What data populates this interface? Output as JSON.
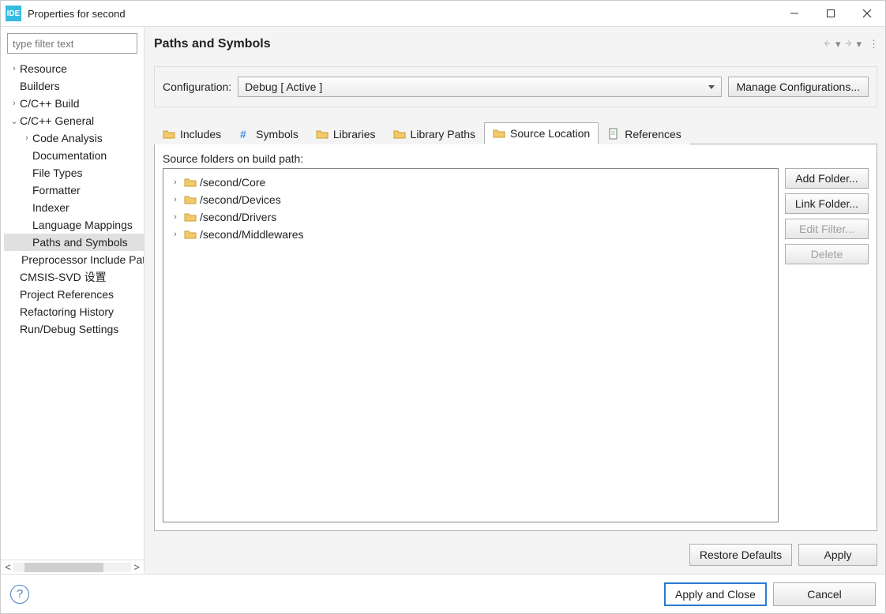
{
  "window": {
    "app_icon_text": "IDE",
    "title": "Properties for second"
  },
  "filter": {
    "placeholder": "type filter text"
  },
  "tree": [
    {
      "label": "Resource",
      "depth": 0,
      "twisty": ">",
      "selected": false
    },
    {
      "label": "Builders",
      "depth": 0,
      "twisty": "",
      "selected": false
    },
    {
      "label": "C/C++ Build",
      "depth": 0,
      "twisty": ">",
      "selected": false
    },
    {
      "label": "C/C++ General",
      "depth": 0,
      "twisty": "v",
      "selected": false
    },
    {
      "label": "Code Analysis",
      "depth": 1,
      "twisty": ">",
      "selected": false
    },
    {
      "label": "Documentation",
      "depth": 1,
      "twisty": "",
      "selected": false
    },
    {
      "label": "File Types",
      "depth": 1,
      "twisty": "",
      "selected": false
    },
    {
      "label": "Formatter",
      "depth": 1,
      "twisty": "",
      "selected": false
    },
    {
      "label": "Indexer",
      "depth": 1,
      "twisty": "",
      "selected": false
    },
    {
      "label": "Language Mappings",
      "depth": 1,
      "twisty": "",
      "selected": false
    },
    {
      "label": "Paths and Symbols",
      "depth": 1,
      "twisty": "",
      "selected": true
    },
    {
      "label": "Preprocessor Include Paths",
      "depth": 1,
      "twisty": "",
      "selected": false
    },
    {
      "label": "CMSIS-SVD 设置",
      "depth": 0,
      "twisty": "",
      "selected": false
    },
    {
      "label": "Project References",
      "depth": 0,
      "twisty": "",
      "selected": false
    },
    {
      "label": "Refactoring History",
      "depth": 0,
      "twisty": "",
      "selected": false
    },
    {
      "label": "Run/Debug Settings",
      "depth": 0,
      "twisty": "",
      "selected": false
    }
  ],
  "page": {
    "title": "Paths and Symbols",
    "config_label": "Configuration:",
    "config_value": "Debug  [ Active ]",
    "manage_btn": "Manage Configurations..."
  },
  "tabs": [
    {
      "label": "Includes",
      "icon": "includes",
      "active": false
    },
    {
      "label": "Symbols",
      "icon": "hash",
      "active": false
    },
    {
      "label": "Libraries",
      "icon": "libraries",
      "active": false
    },
    {
      "label": "Library Paths",
      "icon": "folder",
      "active": false
    },
    {
      "label": "Source Location",
      "icon": "folder-src",
      "active": true
    },
    {
      "label": "References",
      "icon": "doc",
      "active": false
    }
  ],
  "source": {
    "caption": "Source folders on build path:",
    "folders": [
      "/second/Core",
      "/second/Devices",
      "/second/Drivers",
      "/second/Middlewares"
    ],
    "buttons": {
      "add": "Add Folder...",
      "link": "Link Folder...",
      "edit": "Edit Filter...",
      "delete": "Delete"
    }
  },
  "footer": {
    "restore": "Restore Defaults",
    "apply": "Apply",
    "apply_close": "Apply and Close",
    "cancel": "Cancel"
  }
}
